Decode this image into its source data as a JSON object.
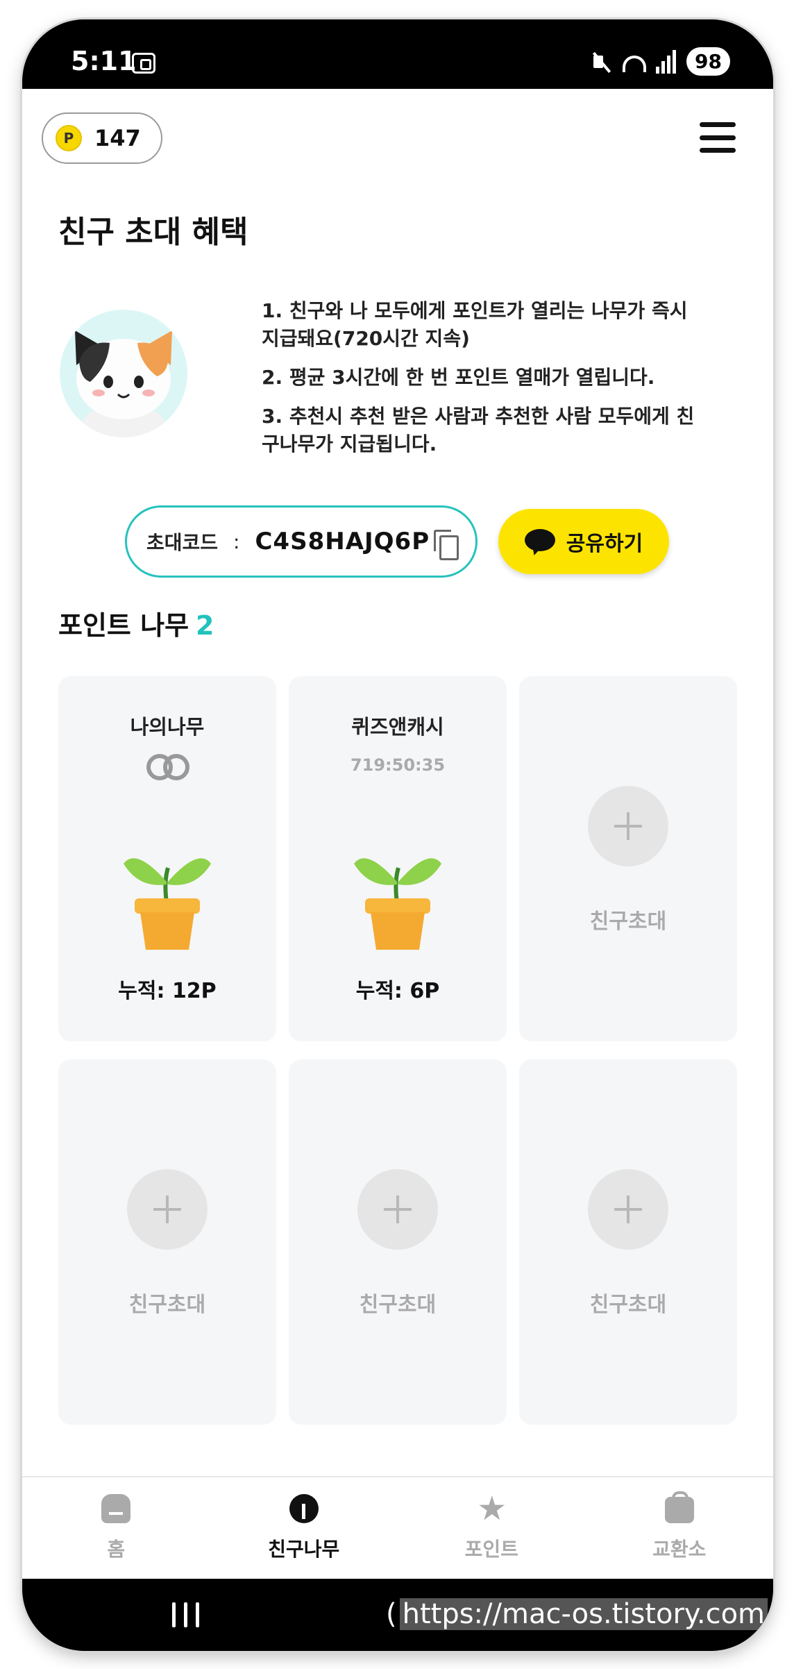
{
  "status_bar": {
    "time": "5:11",
    "battery": "98"
  },
  "header": {
    "points_icon_letter": "P",
    "points": "147"
  },
  "page": {
    "title": "친구 초대 혜택",
    "benefits": [
      "1. 친구와 나 모두에게 포인트가 열리는 나무가 즉시 지급돼요(720시간 지속)",
      "2. 평균 3시간에 한 번 포인트 열매가 열립니다.",
      "3. 추천시 추천 받은 사람과 추천한 사람 모두에게 친구나무가 지급됩니다."
    ],
    "invite_label": "초대코드",
    "invite_colon": ":",
    "invite_code": "C4S8HAJQ6P",
    "share_label": "공유하기"
  },
  "trees_section": {
    "title": "포인트 나무",
    "count": "2",
    "cards": [
      {
        "name": "나의나무",
        "accumulated": "누적: 12P"
      },
      {
        "name": "퀴즈앤캐시",
        "timer": "719:50:35",
        "accumulated": "누적: 6P"
      }
    ],
    "invite_slot_label": "친구초대"
  },
  "bottom_nav": [
    {
      "label": "홈",
      "icon": "home-icon"
    },
    {
      "label": "친구나무",
      "icon": "tree-icon"
    },
    {
      "label": "포인트",
      "icon": "star-icon"
    },
    {
      "label": "교환소",
      "icon": "bag-icon"
    }
  ],
  "watermark": {
    "prefix": "(",
    "url": "https://mac-os.tistory.com"
  },
  "colors": {
    "accent_teal": "#27c2bd",
    "share_yellow": "#fde400",
    "card_bg": "#f5f6f8",
    "inactive_gray": "#aaaaaa"
  }
}
